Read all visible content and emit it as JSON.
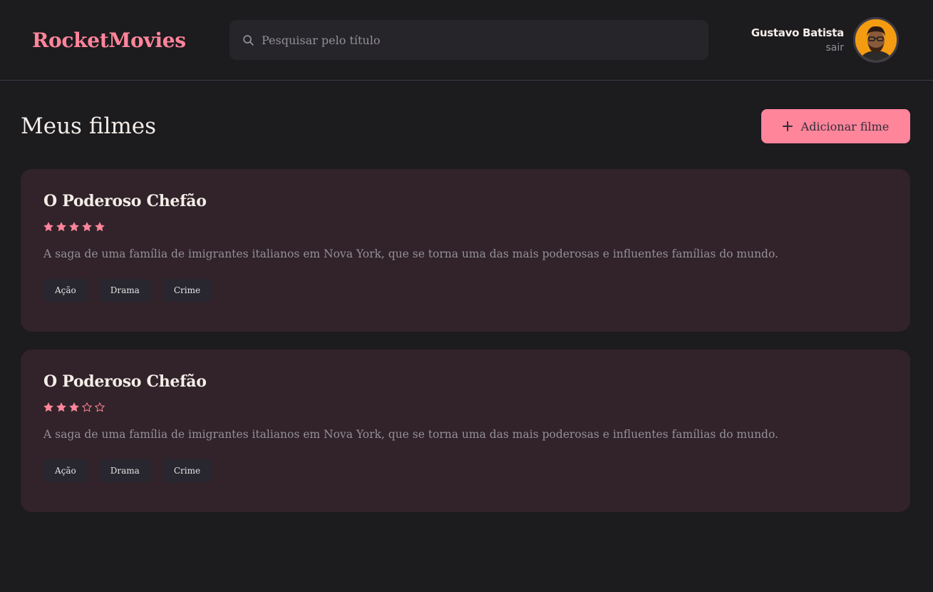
{
  "header": {
    "brand": "RocketMovies",
    "search_placeholder": "Pesquisar pelo título",
    "user_name": "Gustavo Batista",
    "logout_label": "sair"
  },
  "main": {
    "title": "Meus filmes",
    "add_button_label": "Adicionar filme",
    "movies": [
      {
        "title": "O Poderoso Chefão",
        "rating": 5,
        "description": "A saga de uma família de imigrantes italianos em Nova York, que se torna uma das mais poderosas e influentes famílias do mundo.",
        "tags": [
          "Ação",
          "Drama",
          "Crime"
        ]
      },
      {
        "title": "O Poderoso Chefão",
        "rating": 3,
        "description": "A saga de uma família de imigrantes italianos em Nova York, que se torna uma das mais poderosas e influentes famílias do mundo.",
        "tags": [
          "Ação",
          "Drama",
          "Crime"
        ]
      }
    ]
  },
  "colors": {
    "accent": "#FF859B",
    "background": "#1C1B1E",
    "card": "#312329",
    "tag": "#28262E",
    "muted_text": "#948F99"
  },
  "icons": {
    "search": "search-icon",
    "add": "plus-icon",
    "star_filled": "star-filled-icon",
    "star_empty": "star-outline-icon"
  }
}
